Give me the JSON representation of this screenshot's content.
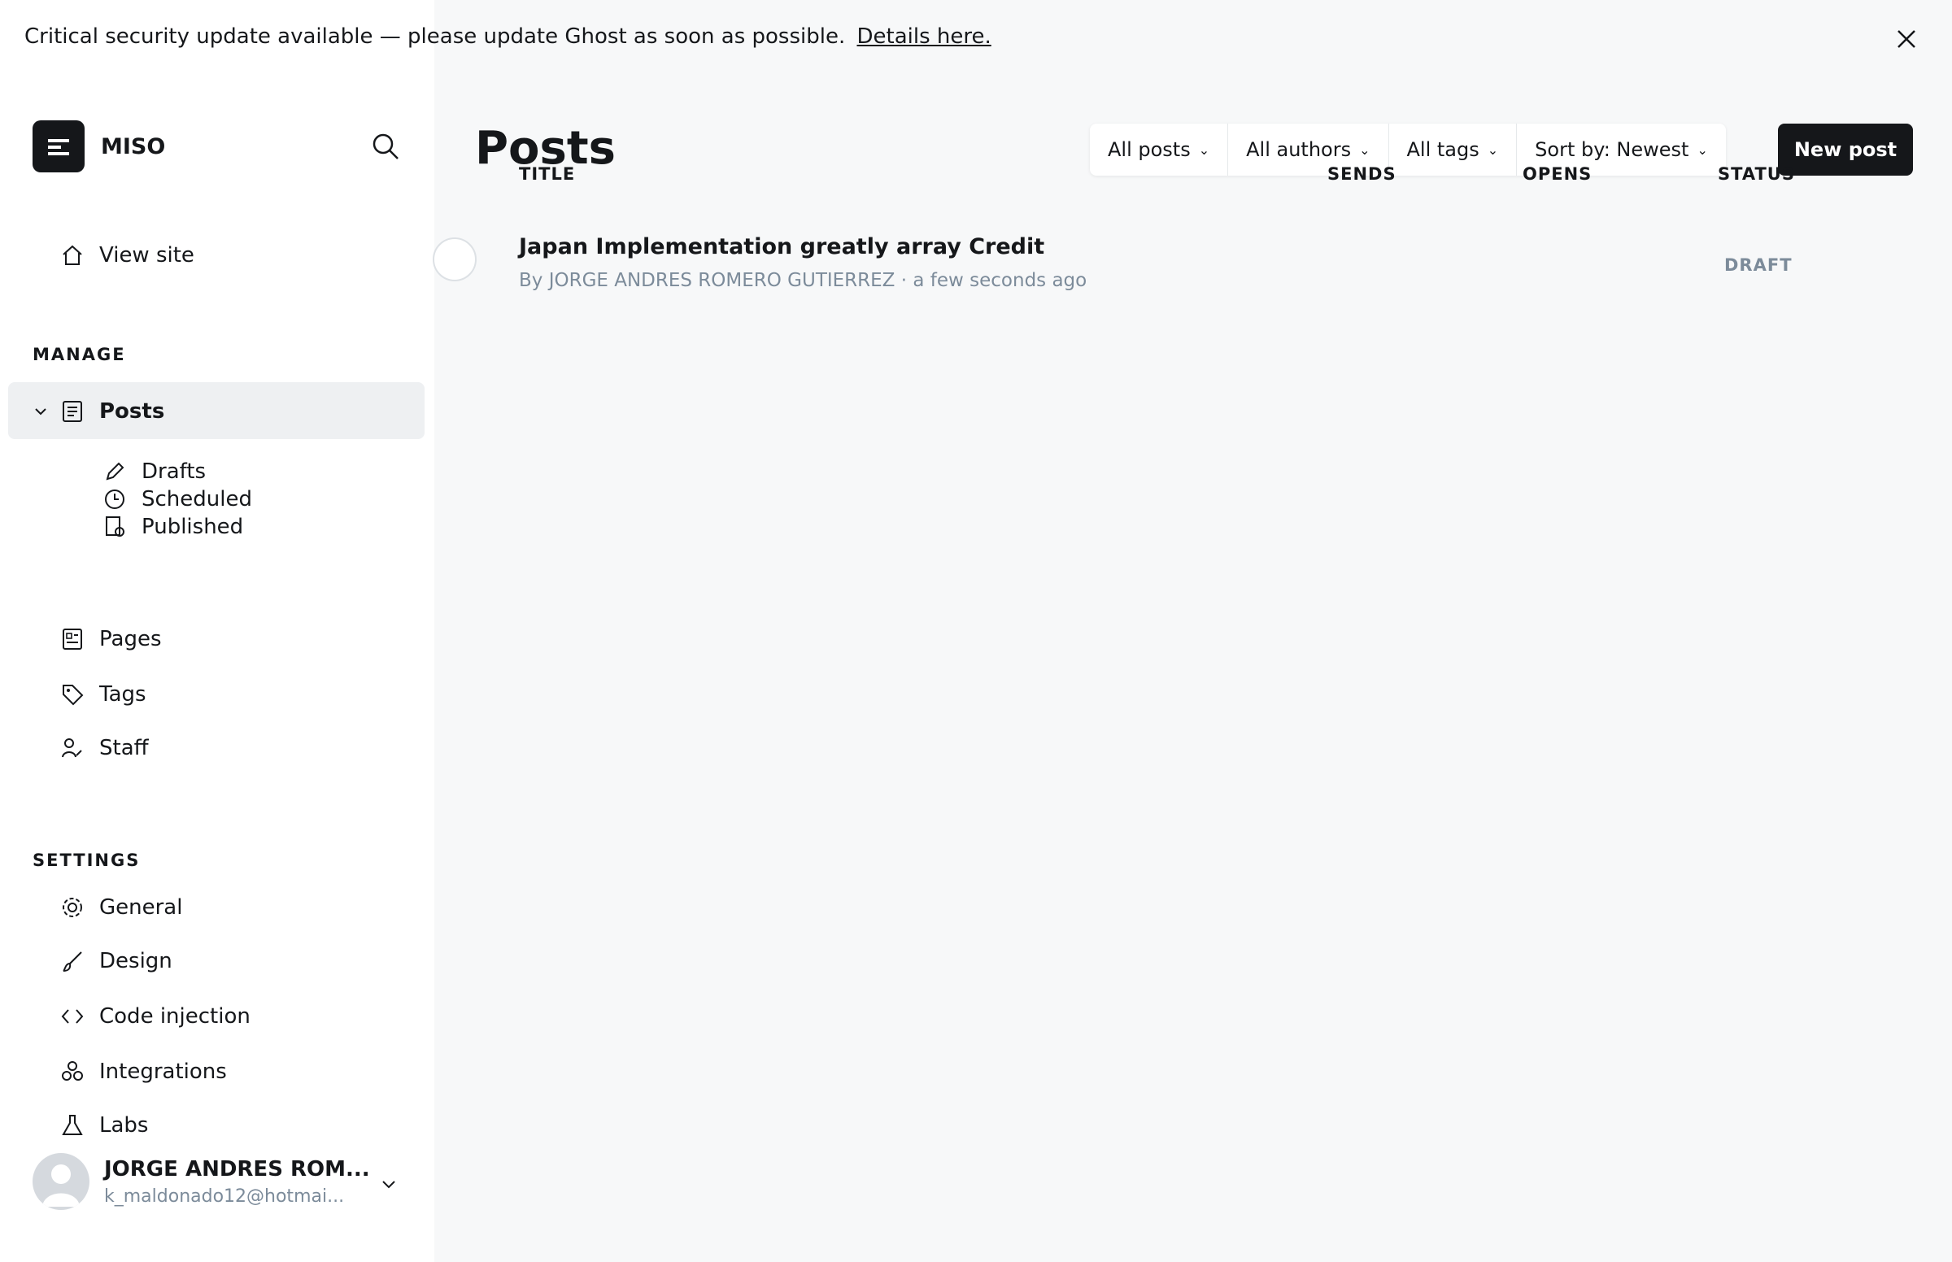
{
  "banner": {
    "text": "Critical security update available — please update Ghost as soon as possible.",
    "link": "Details here."
  },
  "brand": {
    "name": "MISO"
  },
  "nav": {
    "view_site": "View site",
    "manage_label": "MANAGE",
    "posts": "Posts",
    "drafts": "Drafts",
    "scheduled": "Scheduled",
    "published": "Published",
    "pages": "Pages",
    "tags": "Tags",
    "staff": "Staff",
    "settings_label": "SETTINGS",
    "general": "General",
    "design": "Design",
    "code_injection": "Code injection",
    "integrations": "Integrations",
    "labs": "Labs"
  },
  "user": {
    "name": "JORGE ANDRES ROM...",
    "email": "k_maldonado12@hotmai..."
  },
  "header": {
    "title": "Posts",
    "filters": [
      "All posts",
      "All authors",
      "All tags",
      "Sort by: Newest"
    ],
    "new_post": "New post"
  },
  "table": {
    "columns": [
      "TITLE",
      "SENDS",
      "OPENS",
      "STATUS"
    ],
    "rows": [
      {
        "title": "Japan Implementation greatly array Credit",
        "meta": "By JORGE ANDRES ROMERO GUTIERREZ · a few seconds ago",
        "status": "DRAFT"
      }
    ]
  }
}
